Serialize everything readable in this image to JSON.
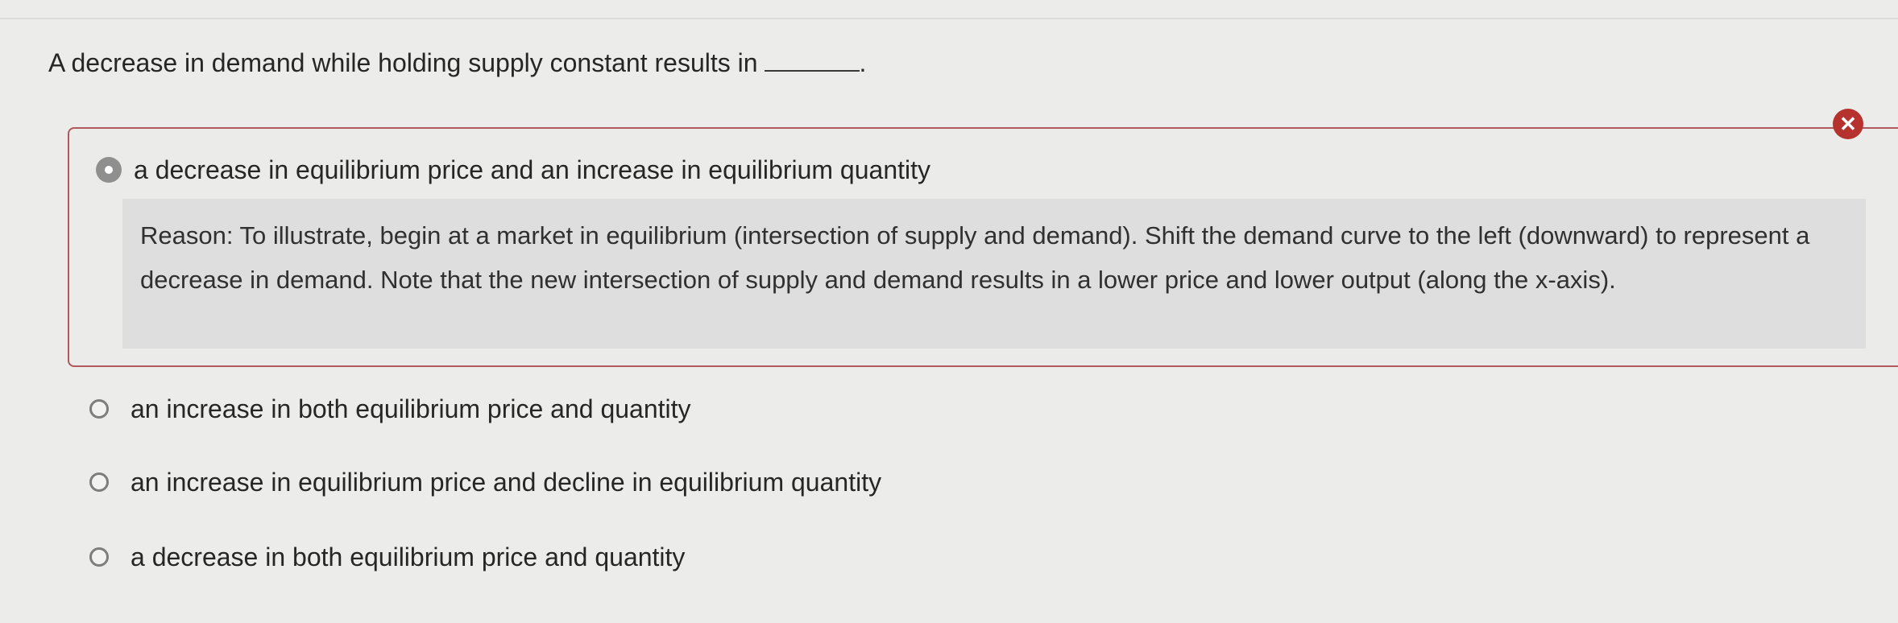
{
  "question": {
    "text": "A decrease in demand while holding supply constant results in",
    "punct": "."
  },
  "selected_choice": {
    "label": "a decrease in equilibrium price and an increase in equilibrium quantity",
    "status_icon": "x-icon",
    "status_symbol": "✕",
    "status_color": "#b5322f",
    "reason": "Reason: To illustrate, begin at a market in equilibrium (intersection of supply and demand). Shift the demand curve to the left (downward) to represent a decrease in demand. Note that the new intersection of supply and demand results in a lower price and lower output (along the x-axis)."
  },
  "other_choices": [
    {
      "label": "an increase in both equilibrium price and quantity"
    },
    {
      "label": "an increase in equilibrium price and decline in equilibrium quantity"
    },
    {
      "label": "a decrease in both equilibrium price and quantity"
    }
  ]
}
